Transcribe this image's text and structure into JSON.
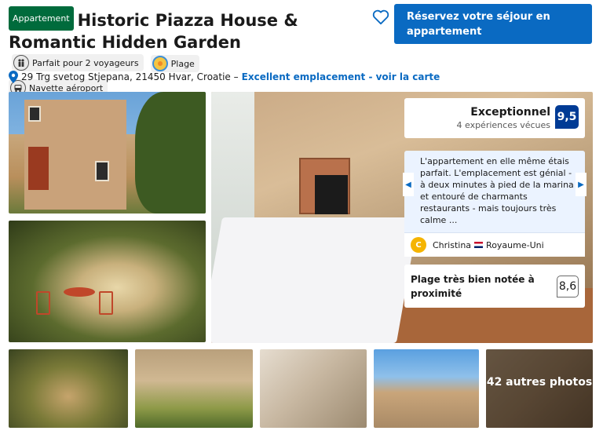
{
  "header": {
    "type_badge": "Appartement",
    "title": "Historic Piazza House & Romantic Hidden Garden",
    "chips": [
      {
        "label": "Parfait pour 2 voyageurs",
        "icon": "people-icon"
      },
      {
        "label": "Plage",
        "icon": "beach-icon"
      },
      {
        "label": "Navette aéroport",
        "icon": "shuttle-icon"
      }
    ]
  },
  "reserve_button": "Réservez votre séjour en appartement",
  "address": {
    "text": "29 Trg svetog Stjepana, 21450 Hvar, Croatie –",
    "link": "Excellent emplacement - voir la carte"
  },
  "review": {
    "label": "Exceptionnel",
    "count": "4 expériences vécues",
    "score": "9,5",
    "quote": "L'appartement en elle même étais parfait. L'emplacement est génial - à deux minutes à pied de la marina et entouré de charmants restaurants - mais toujours très calme ...",
    "reviewer_initial": "C",
    "reviewer_name": "Christina",
    "reviewer_country": "Royaume-Uni"
  },
  "beach_rating": {
    "label": "Plage très bien notée à proximité",
    "score": "8,6"
  },
  "more_photos": "42 autres photos",
  "colors": {
    "accent": "#0a6ac2",
    "score_badge": "#003b95",
    "type_badge": "#006b3c",
    "avatar": "#f5b400"
  }
}
